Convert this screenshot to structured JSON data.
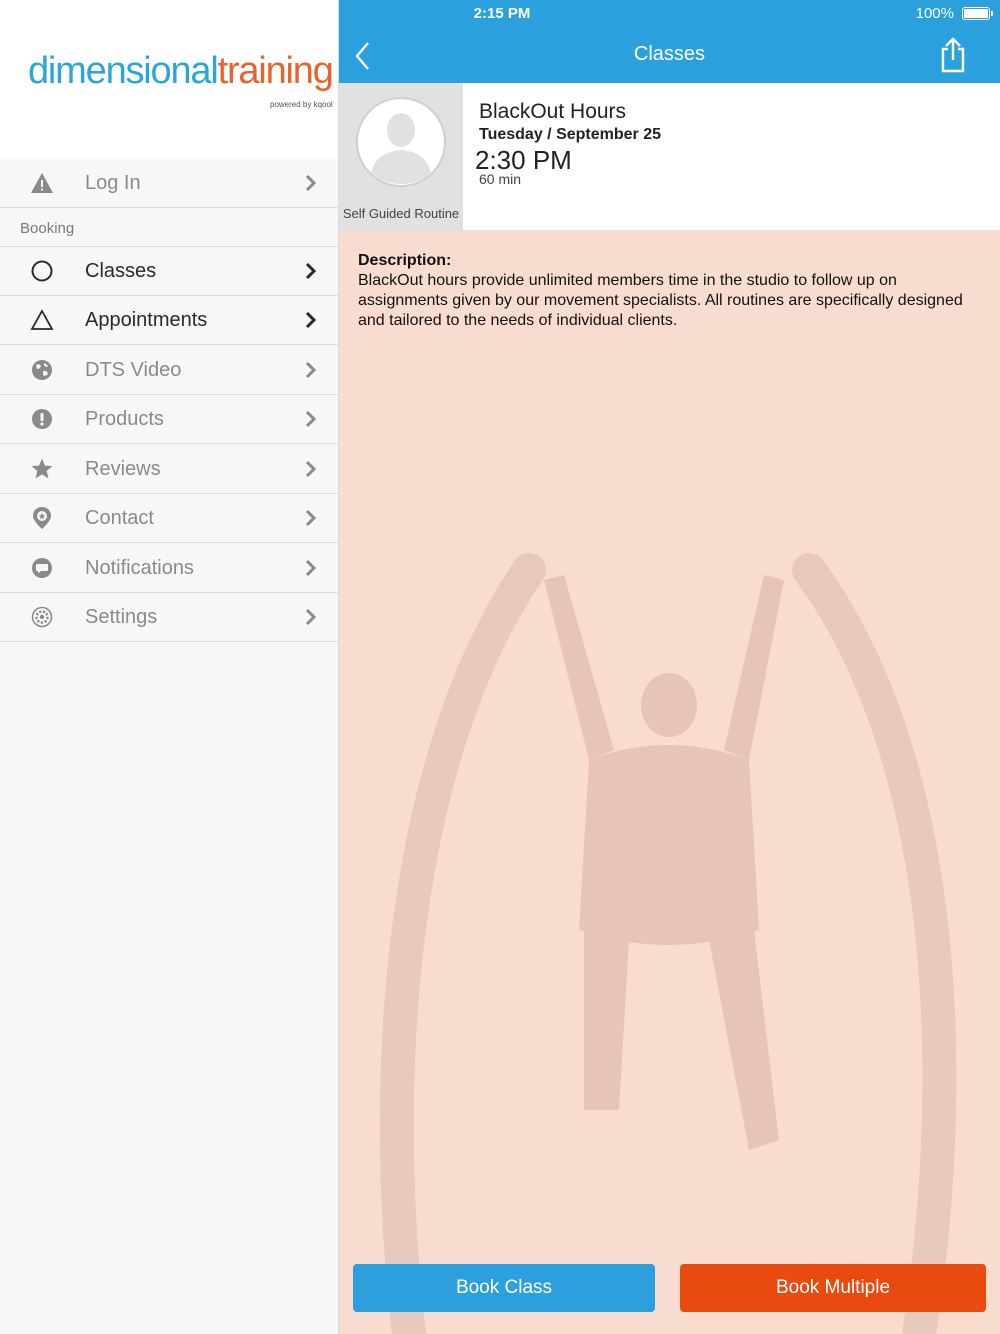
{
  "brand": {
    "logo_part1": "dimensional",
    "logo_part2": "training",
    "logo_sub": "powered by kqool"
  },
  "sidebar": {
    "login_label": "Log In",
    "section_label": "Booking",
    "items": [
      {
        "label": "Classes",
        "icon": "circle-outline-icon"
      },
      {
        "label": "Appointments",
        "icon": "triangle-outline-icon"
      },
      {
        "label": "DTS Video",
        "icon": "globe-icon"
      },
      {
        "label": "Products",
        "icon": "exclamation-circle-icon"
      },
      {
        "label": "Reviews",
        "icon": "star-icon"
      },
      {
        "label": "Contact",
        "icon": "location-pin-icon"
      },
      {
        "label": "Notifications",
        "icon": "chat-bubble-icon"
      },
      {
        "label": "Settings",
        "icon": "gear-icon"
      }
    ]
  },
  "status_bar": {
    "time": "2:15 PM",
    "battery": "100%"
  },
  "navbar": {
    "title": "Classes"
  },
  "class": {
    "avatar_caption": "Self Guided Routine",
    "name": "BlackOut Hours",
    "date": "Tuesday / September 25",
    "time": "2:30 PM",
    "duration": "60 min"
  },
  "description": {
    "label": "Description:",
    "text": "BlackOut hours provide unlimited members time in the studio to follow up on assignments given by our movement specialists. All routines are specifically designed and tailored to the needs of individual clients."
  },
  "actions": {
    "book_class": "Book Class",
    "book_multiple": "Book Multiple"
  },
  "colors": {
    "accent_blue": "#2aa1dc",
    "accent_orange": "#e84a0f",
    "content_bg": "#f9dcd0"
  }
}
